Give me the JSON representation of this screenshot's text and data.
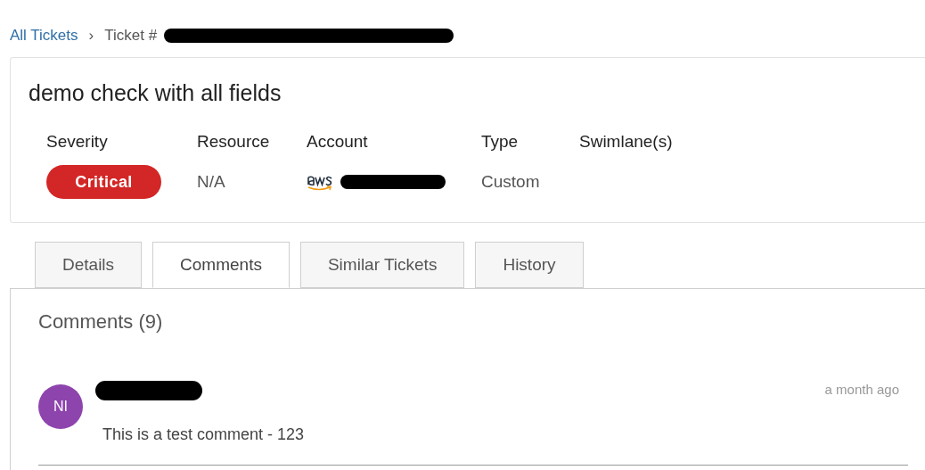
{
  "breadcrumb": {
    "link": "All Tickets",
    "separator": "›",
    "current": "Ticket #"
  },
  "ticket": {
    "title": "demo check with all fields",
    "fields": [
      {
        "label": "Severity",
        "kind": "badge",
        "value": "Critical",
        "color": "#d32626"
      },
      {
        "label": "Resource",
        "kind": "text",
        "value": "N/A"
      },
      {
        "label": "Account",
        "kind": "aws"
      },
      {
        "label": "Type",
        "kind": "text",
        "value": "Custom"
      },
      {
        "label": "Swimlane(s)",
        "kind": "empty"
      }
    ]
  },
  "tabs": [
    {
      "label": "Details",
      "selected": false
    },
    {
      "label": "Comments",
      "selected": true
    },
    {
      "label": "Similar Tickets",
      "selected": false
    },
    {
      "label": "History",
      "selected": false
    }
  ],
  "comments": {
    "heading": "Comments (9)",
    "items": [
      {
        "initials": "NI",
        "color": "#8e44ad",
        "time": "a month ago",
        "text": "This is a test comment - 123"
      }
    ]
  }
}
